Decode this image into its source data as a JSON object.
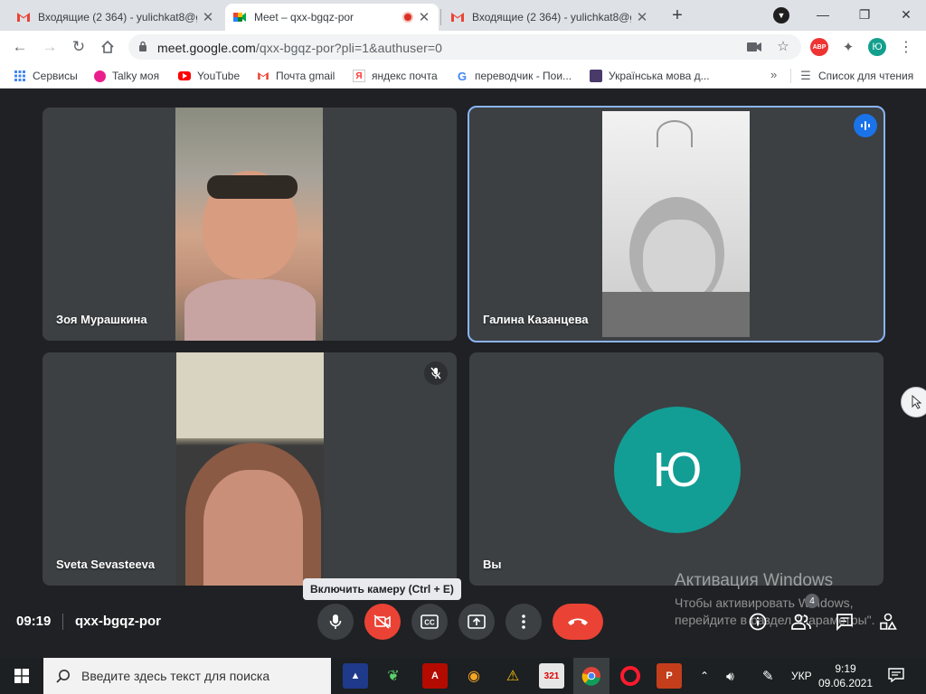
{
  "browser": {
    "tabs": [
      {
        "title": "Входящие (2 364) - yulichkat8@g",
        "icon": "gmail-icon",
        "active": false
      },
      {
        "title": "Meet – qxx-bgqz-por",
        "icon": "google-meet-icon",
        "active": true,
        "recording": true
      },
      {
        "title": "Входящие (2 364) - yulichkat8@g",
        "icon": "gmail-icon",
        "active": false
      }
    ],
    "new_tab": "+",
    "url_host": "meet.google.com",
    "url_path": "/qxx-bgqz-por?pli=1&authuser=0",
    "profile_initial": "Ю",
    "abp_label": "ABP",
    "bookmarks": [
      {
        "label": "Сервисы",
        "icon": "apps-grid-icon"
      },
      {
        "label": "Talky моя",
        "icon": "talky-icon"
      },
      {
        "label": "YouTube",
        "icon": "youtube-icon"
      },
      {
        "label": "Почта gmail",
        "icon": "gmail-icon"
      },
      {
        "label": "яндекс почта",
        "icon": "yandex-icon",
        "glyph": "Я"
      },
      {
        "label": "переводчик - Пои...",
        "icon": "google-icon",
        "glyph": "G"
      },
      {
        "label": "Українська мова д...",
        "icon": "site-icon"
      }
    ],
    "bookmarks_more": "»",
    "reading_list": "Список для чтения"
  },
  "meet": {
    "participants": [
      {
        "name": "Зоя Мурашкина",
        "muted": false,
        "speaking": false
      },
      {
        "name": "Галина Казанцева",
        "muted": false,
        "speaking": true
      },
      {
        "name": "Sveta Sevasteeva",
        "muted": true,
        "speaking": false
      },
      {
        "name": "Вы",
        "muted": false,
        "speaking": false,
        "avatar_letter": "Ю",
        "avatar_color": "#129e94"
      }
    ],
    "tooltip": "Включить камеру (Ctrl + E)",
    "time": "09:19",
    "meeting_code": "qxx-bgqz-por",
    "people_count": "4",
    "accent": "#8ab4f8",
    "end_call_color": "#ea4335"
  },
  "watermark": {
    "line1": "Активация Windows",
    "line2": "Чтобы активировать Windows,",
    "line3": "перейдите в раздел \"Параметры\"."
  },
  "taskbar": {
    "search_placeholder": "Введите здесь текст для поиска",
    "language": "УКР",
    "time": "9:19",
    "date": "09.06.2021",
    "apps": [
      "file-manager-icon",
      "app-green-icon",
      "acrobat-icon",
      "eye-app-icon",
      "archicad-icon",
      "video-editor-icon",
      "chrome-icon",
      "opera-icon",
      "powerpoint-icon"
    ]
  }
}
